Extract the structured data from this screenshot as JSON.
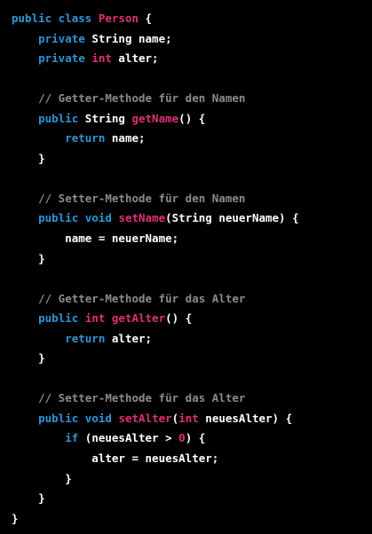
{
  "editor": {
    "lines": [
      [
        {
          "t": "public class ",
          "c": "kw"
        },
        {
          "t": "Person",
          "c": "tp"
        },
        {
          "t": " {",
          "c": "nm"
        }
      ],
      [
        {
          "t": "    private ",
          "c": "kw"
        },
        {
          "t": "String name;",
          "c": "nm"
        }
      ],
      [
        {
          "t": "    private ",
          "c": "kw"
        },
        {
          "t": "int",
          "c": "tp"
        },
        {
          "t": " alter;",
          "c": "nm"
        }
      ],
      [],
      [
        {
          "t": "    // Getter-Methode für den Namen",
          "c": "cm"
        }
      ],
      [
        {
          "t": "    public ",
          "c": "kw"
        },
        {
          "t": "String ",
          "c": "nm"
        },
        {
          "t": "getName",
          "c": "tp"
        },
        {
          "t": "() {",
          "c": "nm"
        }
      ],
      [
        {
          "t": "        return ",
          "c": "kw"
        },
        {
          "t": "name;",
          "c": "nm"
        }
      ],
      [
        {
          "t": "    }",
          "c": "nm"
        }
      ],
      [],
      [
        {
          "t": "    // Setter-Methode für den Namen",
          "c": "cm"
        }
      ],
      [
        {
          "t": "    public ",
          "c": "kw"
        },
        {
          "t": "void ",
          "c": "kw"
        },
        {
          "t": "setName",
          "c": "tp"
        },
        {
          "t": "(String neuerName) {",
          "c": "nm"
        }
      ],
      [
        {
          "t": "        name = neuerName;",
          "c": "nm"
        }
      ],
      [
        {
          "t": "    }",
          "c": "nm"
        }
      ],
      [],
      [
        {
          "t": "    // Getter-Methode für das Alter",
          "c": "cm"
        }
      ],
      [
        {
          "t": "    public ",
          "c": "kw"
        },
        {
          "t": "int ",
          "c": "tp"
        },
        {
          "t": "getAlter",
          "c": "tp"
        },
        {
          "t": "() {",
          "c": "nm"
        }
      ],
      [
        {
          "t": "        return ",
          "c": "kw"
        },
        {
          "t": "alter;",
          "c": "nm"
        }
      ],
      [
        {
          "t": "    }",
          "c": "nm"
        }
      ],
      [],
      [
        {
          "t": "    // Setter-Methode für das Alter",
          "c": "cm"
        }
      ],
      [
        {
          "t": "    public ",
          "c": "kw"
        },
        {
          "t": "void ",
          "c": "kw"
        },
        {
          "t": "setAlter",
          "c": "tp"
        },
        {
          "t": "(",
          "c": "nm"
        },
        {
          "t": "int",
          "c": "tp"
        },
        {
          "t": " neuesAlter) {",
          "c": "nm"
        }
      ],
      [
        {
          "t": "        if ",
          "c": "kw"
        },
        {
          "t": "(neuesAlter > ",
          "c": "nm"
        },
        {
          "t": "0",
          "c": "num"
        },
        {
          "t": ") {",
          "c": "nm"
        }
      ],
      [
        {
          "t": "            alter = neuesAlter;",
          "c": "nm"
        }
      ],
      [
        {
          "t": "        }",
          "c": "nm"
        }
      ],
      [
        {
          "t": "    }",
          "c": "nm"
        }
      ],
      [
        {
          "t": "}",
          "c": "nm"
        }
      ]
    ]
  },
  "colors": {
    "background": "#000000",
    "keyword": "#2e95d3",
    "type_or_method": "#df3079",
    "comment": "#8b8b8b",
    "plain": "#ffffff"
  }
}
